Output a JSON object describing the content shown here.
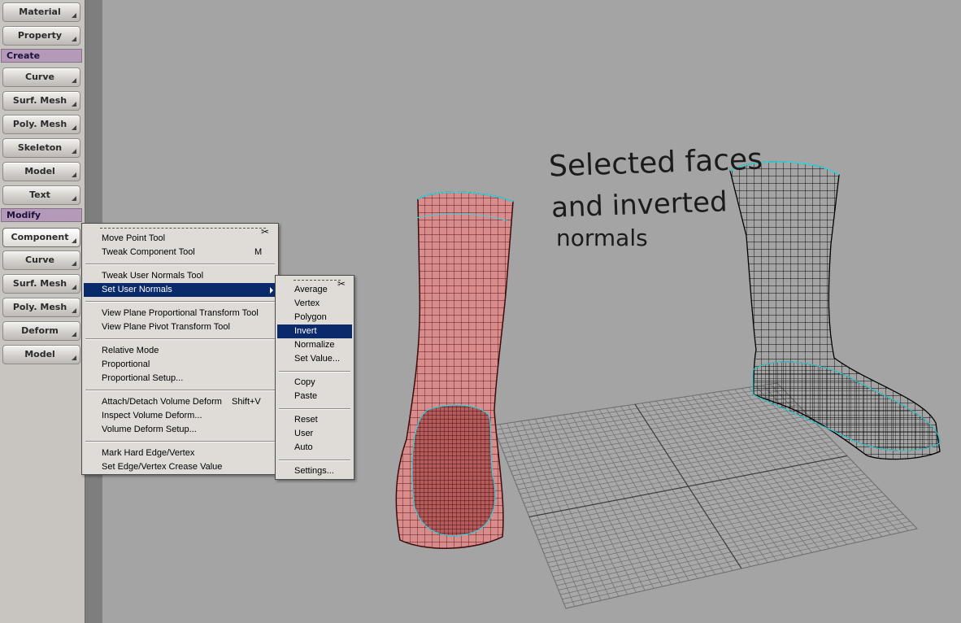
{
  "toolbar": {
    "buttons_top": [
      "Material",
      "Property"
    ],
    "create_section": "Create",
    "create_buttons": [
      "Curve",
      "Surf. Mesh",
      "Poly. Mesh",
      "Skeleton",
      "Model",
      "Text"
    ],
    "modify_section": "Modify",
    "modify_buttons": [
      "Component",
      "Curve",
      "Surf. Mesh",
      "Poly. Mesh",
      "Deform",
      "Model"
    ]
  },
  "component_menu": {
    "items": [
      {
        "label": "Move Point Tool",
        "shortcut": ""
      },
      {
        "label": "Tweak Component Tool",
        "shortcut": "M"
      },
      {
        "label": "Tweak User Normals Tool",
        "shortcut": ""
      },
      {
        "label": "Set User Normals",
        "shortcut": ""
      },
      {
        "label": "View Plane Proportional Transform Tool",
        "shortcut": ""
      },
      {
        "label": "View Plane Pivot Transform Tool",
        "shortcut": ""
      },
      {
        "label": "Relative Mode",
        "shortcut": ""
      },
      {
        "label": "Proportional",
        "shortcut": ""
      },
      {
        "label": "Proportional Setup...",
        "shortcut": ""
      },
      {
        "label": "Attach/Detach Volume Deform",
        "shortcut": "Shift+V"
      },
      {
        "label": "Inspect Volume Deform...",
        "shortcut": ""
      },
      {
        "label": "Volume Deform Setup...",
        "shortcut": ""
      },
      {
        "label": "Mark Hard Edge/Vertex",
        "shortcut": ""
      },
      {
        "label": "Set Edge/Vertex Crease Value",
        "shortcut": ""
      }
    ]
  },
  "normals_submenu": {
    "items": [
      "Average",
      "Vertex",
      "Polygon",
      "Invert",
      "Normalize",
      "Set Value...",
      "Copy",
      "Paste",
      "Reset",
      "User",
      "Auto",
      "Settings..."
    ]
  },
  "viewport": {
    "annotation_lines": [
      "Selected faces",
      "and inverted",
      "normals"
    ]
  },
  "colors": {
    "selected_mesh": "#d98c8c",
    "selection_outline": "#34d6e0",
    "menu_highlight": "#0b2a6b",
    "section_header": "#b49ab8"
  }
}
